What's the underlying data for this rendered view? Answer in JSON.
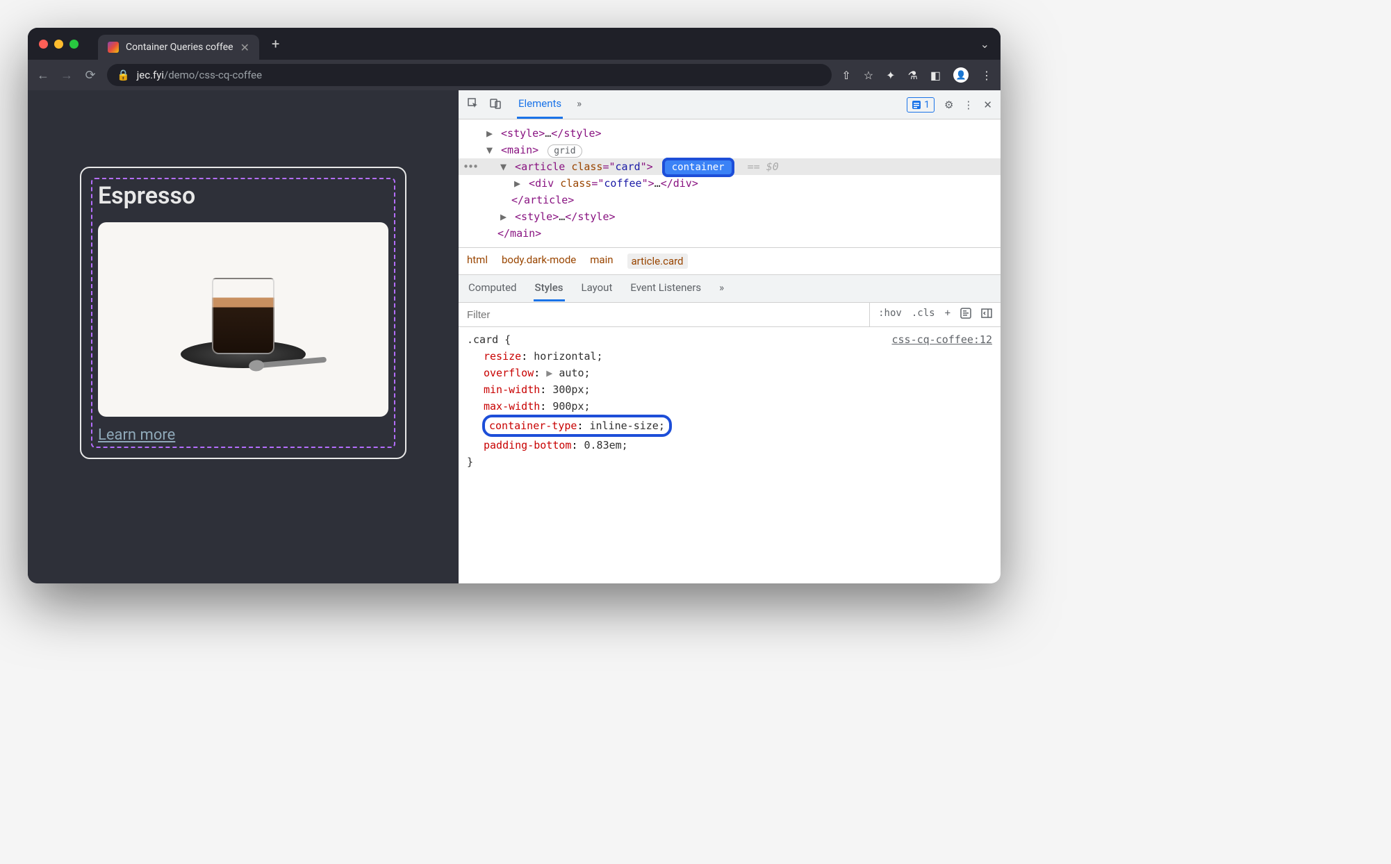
{
  "window": {
    "tab_title": "Container Queries coffee",
    "url_domain": "jec.fyi",
    "url_path": "/demo/css-cq-coffee"
  },
  "page": {
    "card_title": "Espresso",
    "learn_more": "Learn more"
  },
  "devtools": {
    "header_tabs": [
      "Elements"
    ],
    "issue_count": "1",
    "dom": {
      "style_open": "<style>",
      "style_ellipsis": "…",
      "style_close": "</style>",
      "main_open": "<main>",
      "main_badge": "grid",
      "article_open_tag": "article",
      "article_attr_name": "class",
      "article_attr_val": "card",
      "container_badge": "container",
      "eq0": "== $0",
      "div_open_tag": "div",
      "div_attr_name": "class",
      "div_attr_val": "coffee",
      "div_ellipsis": "…",
      "div_close": "</div>",
      "article_close": "</article>",
      "main_close": "</main>"
    },
    "breadcrumb": [
      "html",
      "body.dark-mode",
      "main",
      "article.card"
    ],
    "styles_tabs": [
      "Computed",
      "Styles",
      "Layout",
      "Event Listeners"
    ],
    "filter_placeholder": "Filter",
    "filter_buttons": [
      ":hov",
      ".cls",
      "+"
    ],
    "rule": {
      "selector": ".card {",
      "source": "css-cq-coffee:12",
      "declarations": [
        {
          "prop": "resize",
          "val": "horizontal;"
        },
        {
          "prop": "overflow",
          "val": "auto;",
          "expandable": true
        },
        {
          "prop": "min-width",
          "val": "300px;"
        },
        {
          "prop": "max-width",
          "val": "900px;"
        },
        {
          "prop": "container-type",
          "val": "inline-size;",
          "highlight": true
        },
        {
          "prop": "padding-bottom",
          "val": "0.83em;"
        }
      ],
      "close": "}"
    }
  }
}
